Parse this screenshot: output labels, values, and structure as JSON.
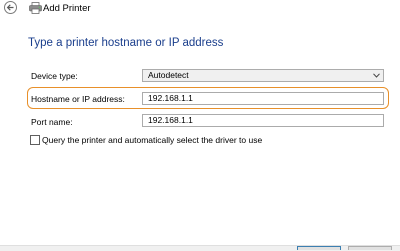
{
  "window": {
    "title": "Add Printer"
  },
  "heading": "Type a printer hostname or IP address",
  "form": {
    "device_type": {
      "label": "Device type:",
      "value": "Autodetect"
    },
    "hostname": {
      "label": "Hostname or IP address:",
      "value": "192.168.1.1"
    },
    "port_name": {
      "label": "Port name:",
      "value": "192.168.1.1"
    },
    "query_checkbox": {
      "label": "Query the printer and automatically select the driver to use",
      "checked": false
    }
  },
  "colors": {
    "heading": "#1a3e8c",
    "highlight": "#e8902a"
  },
  "icons": {
    "back": "back-arrow-icon",
    "app": "printer-icon",
    "dropdown": "chevron-down-icon"
  }
}
